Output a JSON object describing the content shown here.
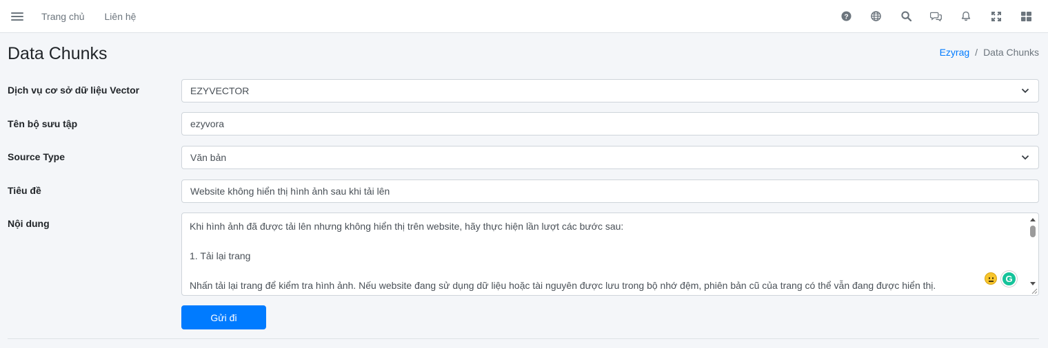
{
  "nav": {
    "links": [
      "Trang chủ",
      "Liên hệ"
    ],
    "icons": [
      "help-icon",
      "globe-icon",
      "search-icon",
      "messages-icon",
      "bell-icon",
      "fullscreen-icon",
      "apps-grid-icon"
    ]
  },
  "page": {
    "title": "Data Chunks",
    "breadcrumb": {
      "root": "Ezyrag",
      "separator": "/",
      "current": "Data Chunks"
    }
  },
  "form": {
    "vector_service": {
      "label": "Dịch vụ cơ sở dữ liệu Vector",
      "value": "EZYVECTOR"
    },
    "collection_name": {
      "label": "Tên bộ sưu tập",
      "value": "ezyvora"
    },
    "source_type": {
      "label": "Source Type",
      "value": "Văn bản"
    },
    "title": {
      "label": "Tiêu đề",
      "value": "Website không hiển thị hình ảnh sau khi tải lên"
    },
    "content": {
      "label": "Nội dung",
      "lines": [
        "Khi hình ảnh đã được tải lên nhưng không hiển thị trên website, hãy thực hiện lần lượt các bước sau:",
        "",
        "1. Tải lại trang",
        "",
        "Nhấn tải lại trang để kiểm tra hình ảnh. Nếu website đang sử dụng dữ liệu hoặc tài nguyên được lưu trong bộ nhớ đệm, phiên bản cũ của trang có thể vẫn đang được hiển thị."
      ]
    },
    "submit_label": "Gửi đi"
  },
  "colors": {
    "primary": "#007bff",
    "navbar_bg": "#ffffff",
    "page_bg": "#f4f6f9",
    "border": "#ced4da"
  }
}
